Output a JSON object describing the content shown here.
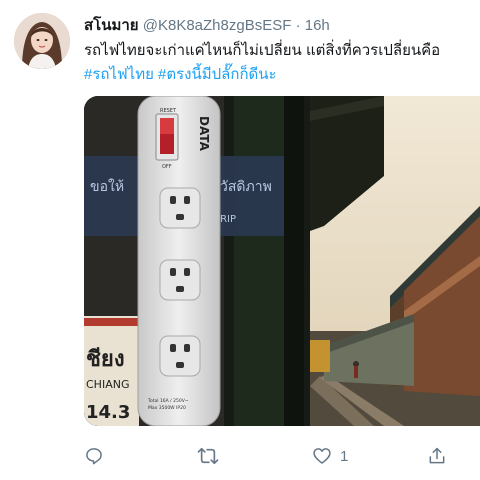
{
  "tweet": {
    "author_name": "สโนมาย",
    "handle": "@K8K8aZh8zgBsESF",
    "separator": "·",
    "time": "16h",
    "text": "รถไฟไทยจะเก่าแค่ไหนก็ไม่เปลี่ยน แต่สิ่งที่ควรเปลี่ยนคือ",
    "hashtags": [
      "#รถไฟไทย",
      "#ตรงนี้มีปลั๊กก็ดีนะ"
    ]
  },
  "media": {
    "power_strip": {
      "brand": "DATA",
      "switch_label_top": "RESET",
      "switch_label_bottom": "OFF",
      "rating_line1": "Total 16A / 250V~",
      "rating_line2": "Max 3500W IP20"
    },
    "station_sign": {
      "line1": "ขอให้",
      "line2": "วัสดิภาพ",
      "line3": "TRIP",
      "line4": "ชียง",
      "line5": "CHIANG",
      "line6": "14.3"
    }
  },
  "actions": {
    "reply_icon": "reply-icon",
    "retweet_icon": "retweet-icon",
    "like_icon": "heart-icon",
    "like_count": "1",
    "share_icon": "share-icon"
  },
  "colors": {
    "link": "#1da1f2",
    "text": "#14171a",
    "muted": "#657786"
  }
}
